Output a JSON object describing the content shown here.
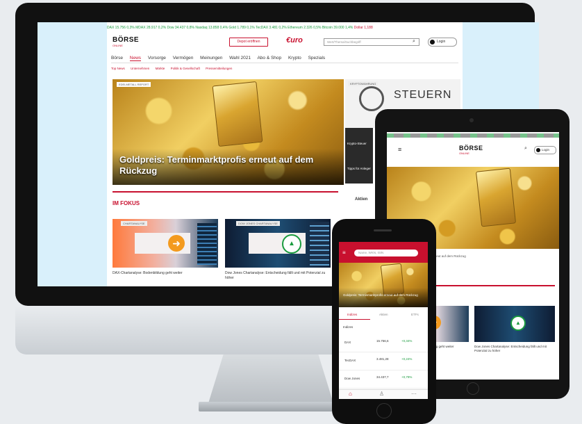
{
  "colors": {
    "brand_red": "#c8102e",
    "ticker_up": "#1a9b3e"
  },
  "desktop": {
    "ticker": [
      {
        "text": "DAX 15.756 0,3%",
        "dir": "up"
      },
      {
        "text": "MDAX 28.917 0,2%",
        "dir": "up"
      },
      {
        "text": "Dow 34.437 0,8%",
        "dir": "up"
      },
      {
        "text": "Nasdaq 13.858 0,4%",
        "dir": "up"
      },
      {
        "text": "Gold 1.789 0,1%",
        "dir": "up"
      },
      {
        "text": "TecDAX 3.481 0,2%",
        "dir": "up"
      },
      {
        "text": "Ethereum 2.326 0,5%",
        "dir": "up"
      },
      {
        "text": "Bitcoin 39.000 1,4%",
        "dir": "up"
      },
      {
        "text": "Dollar 1,188",
        "dir": "down"
      }
    ],
    "logo": {
      "main": "BÖRSE",
      "sub": "ONLINE"
    },
    "header_button": "Depot eröffnen",
    "partner_logo": "€uro",
    "search_placeholder": "Wert/Thema/Suchbegriff",
    "login_label": "Login",
    "nav": [
      "Börse",
      "News",
      "Vorsorge",
      "Vermögen",
      "Meinungen",
      "Wahl 2021",
      "Abo & Shop",
      "Krypto",
      "Spezials"
    ],
    "subnav": [
      "Top News",
      "Unternehmen",
      "Märkte",
      "Politik & Gesellschaft",
      "Pressemitteilungen"
    ],
    "hero": {
      "tag": "EDELMETALL REPORT",
      "title": "Goldpreis: Terminmarktprofis erneut auf dem Rückzug"
    },
    "side_tag": "KRYPTOWÄHRUNG",
    "side_sign": "STEUERN",
    "side_teasers": [
      "Krypto-Steuer",
      "Tipps für Anleger"
    ],
    "focus_label": "IM FOKUS",
    "aktien_label": "Aktien",
    "cards": [
      {
        "tag": "CHARTANALYSE",
        "caption": "DAX-Chartanalyse: Bodenbildung geht weiter"
      },
      {
        "tag": "DOW JONES CHARTANALYSE",
        "caption": "Dow Jones Chartanalyse: Entscheidung fällt und mit Potenzial zu höher"
      }
    ]
  },
  "tablet": {
    "logo": {
      "main": "BÖRSE",
      "sub": "ONLINE"
    },
    "login_label": "Login",
    "caption": "Goldpreis: Terminmarktprofis erneut auf dem Rückzug",
    "card_captions": [
      "DAX-Chartanalyse: Bodenbildung geht weiter",
      "Dow Jones Chartanalyse: Entscheidung fällt und mit Potenzial zu höher"
    ]
  },
  "phone": {
    "search_placeholder": "Name, WKN, ISIN",
    "hero_title": "Goldpreis: Terminmarktprofis erneut auf dem Rückzug",
    "tabs": [
      "Indizes",
      "Aktien",
      "ETFs"
    ],
    "list_header": "Indizes",
    "rows": [
      {
        "name": "DAX",
        "value": "15.756,6",
        "change": "+0,34%"
      },
      {
        "name": "TecDAX",
        "value": "3.481,28",
        "change": "+0,24%"
      },
      {
        "name": "Dow Jones",
        "value": "34.437,7",
        "change": "+0,79%"
      }
    ],
    "bottom_icons": [
      "home-icon",
      "user-icon",
      "more-icon"
    ]
  }
}
